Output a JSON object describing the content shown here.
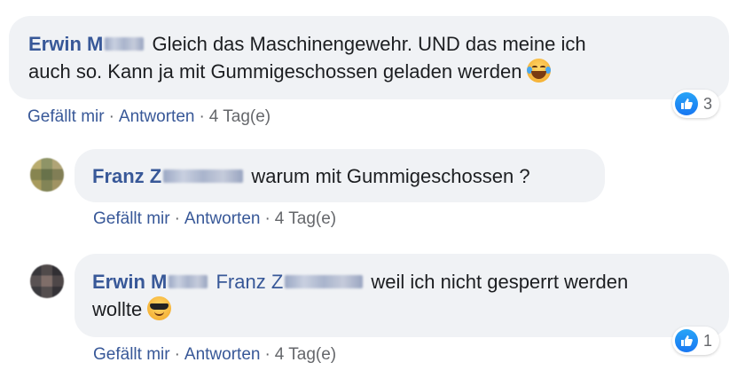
{
  "comments": [
    {
      "author_visible": "Erwin M",
      "text": "Gleich das Maschinengewehr. UND das meine ich auch so. Kann ja mit Gummigeschossen geladen werden",
      "text_line1": "Gleich das Maschinengewehr. UND das meine ich",
      "text_line2": "auch so. Kann ja mit Gummigeschossen geladen werden",
      "emoji": "laughing-with-tears-icon",
      "reaction_count": "3",
      "actions": {
        "like": "Gefällt mir",
        "reply": "Antworten",
        "time": "4 Tag(e)"
      }
    },
    {
      "author_visible": "Franz Z",
      "text": "warum mit Gummigeschossen ?",
      "actions": {
        "like": "Gefällt mir",
        "reply": "Antworten",
        "time": "4 Tag(e)"
      }
    },
    {
      "author_visible": "Erwin M",
      "mention_visible": "Franz Z",
      "text": "weil ich nicht gesperrt werden wollte",
      "text_line1": "weil ich nicht gesperrt werden",
      "text_line2": "wollte",
      "emoji": "sunglasses-face-icon",
      "reaction_count": "1",
      "actions": {
        "like": "Gefällt mir",
        "reply": "Antworten",
        "time": "4 Tag(e)"
      }
    }
  ],
  "separator": "·",
  "colors": {
    "link": "#385898",
    "bubble": "#f0f2f5",
    "meta": "#65676b",
    "like": "#1877f2"
  }
}
